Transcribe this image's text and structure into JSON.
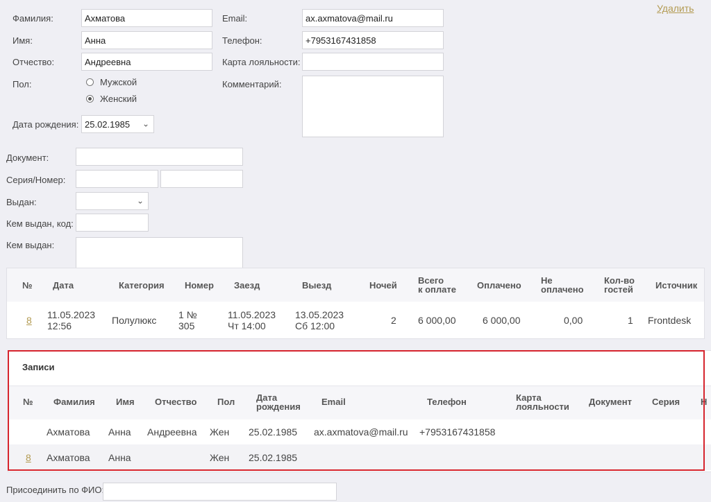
{
  "actions": {
    "delete": "Удалить"
  },
  "person": {
    "labels": {
      "surname": "Фамилия:",
      "name": "Имя:",
      "patronymic": "Отчество:",
      "gender": "Пол:",
      "birthdate": "Дата рождения:",
      "email": "Email:",
      "phone": "Телефон:",
      "loyalty": "Карта лояльности:",
      "comment": "Комментарий:"
    },
    "values": {
      "surname": "Ахматова",
      "name": "Анна",
      "patronymic": "Андреевна",
      "birthdate": "25.02.1985",
      "email": "ax.axmatova@mail.ru",
      "phone": "+7953167431858",
      "loyalty": "",
      "comment": ""
    },
    "gender_options": {
      "male": "Мужской",
      "female": "Женский",
      "selected": "female"
    }
  },
  "document": {
    "labels": {
      "doc": "Документ:",
      "series_number": "Серия/Номер:",
      "issued": "Выдан:",
      "issuer_code": "Кем выдан, код:",
      "issuer": "Кем выдан:"
    },
    "values": {
      "doc": "",
      "series": "",
      "number": "",
      "issued": "",
      "issuer_code": "",
      "issuer": ""
    }
  },
  "bookings": {
    "headers": {
      "num": "№",
      "date": "Дата",
      "category": "Категория",
      "room": "Номер",
      "checkin": "Заезд",
      "checkout": "Выезд",
      "nights": "Ночей",
      "total_1": "Всего",
      "total_2": "к оплате",
      "paid": "Оплачено",
      "unpaid_1": "Не",
      "unpaid_2": "оплачено",
      "guests_1": "Кол-во",
      "guests_2": "гостей",
      "source": "Источник"
    },
    "rows": [
      {
        "num": "8",
        "date_1": "11.05.2023",
        "date_2": "12:56",
        "category": "Полулюкс",
        "room_1": "1 №",
        "room_2": "305",
        "checkin_1": "11.05.2023",
        "checkin_2": "Чт 14:00",
        "checkout_1": "13.05.2023",
        "checkout_2": "Сб 12:00",
        "nights": "2",
        "total": "6 000,00",
        "paid": "6 000,00",
        "unpaid": "0,00",
        "guests": "1",
        "source": "Frontdesk"
      }
    ]
  },
  "records": {
    "title": "Записи",
    "headers": {
      "num": "№",
      "surname": "Фамилия",
      "name": "Имя",
      "patronymic": "Отчество",
      "gender": "Пол",
      "birth_1": "Дата",
      "birth_2": "рождения",
      "email": "Email",
      "phone": "Телефон",
      "loyalty_1": "Карта",
      "loyalty_2": "лояльности",
      "document": "Документ",
      "series": "Серия",
      "cut": "Н"
    },
    "rows": [
      {
        "num": "",
        "surname": "Ахматова",
        "name": "Анна",
        "patronymic": "Андреевна",
        "gender": "Жен",
        "birth": "25.02.1985",
        "email": "ax.axmatova@mail.ru",
        "phone": "+7953167431858"
      },
      {
        "num": "8",
        "surname": "Ахматова",
        "name": "Анна",
        "patronymic": "",
        "gender": "Жен",
        "birth": "25.02.1985",
        "email": "",
        "phone": ""
      }
    ]
  },
  "join": {
    "label": "Присоединить по ФИО:",
    "value": ""
  },
  "colors": {
    "accent_link": "#b39b52",
    "highlight_frame": "#d6242d",
    "background": "#efeff4"
  }
}
